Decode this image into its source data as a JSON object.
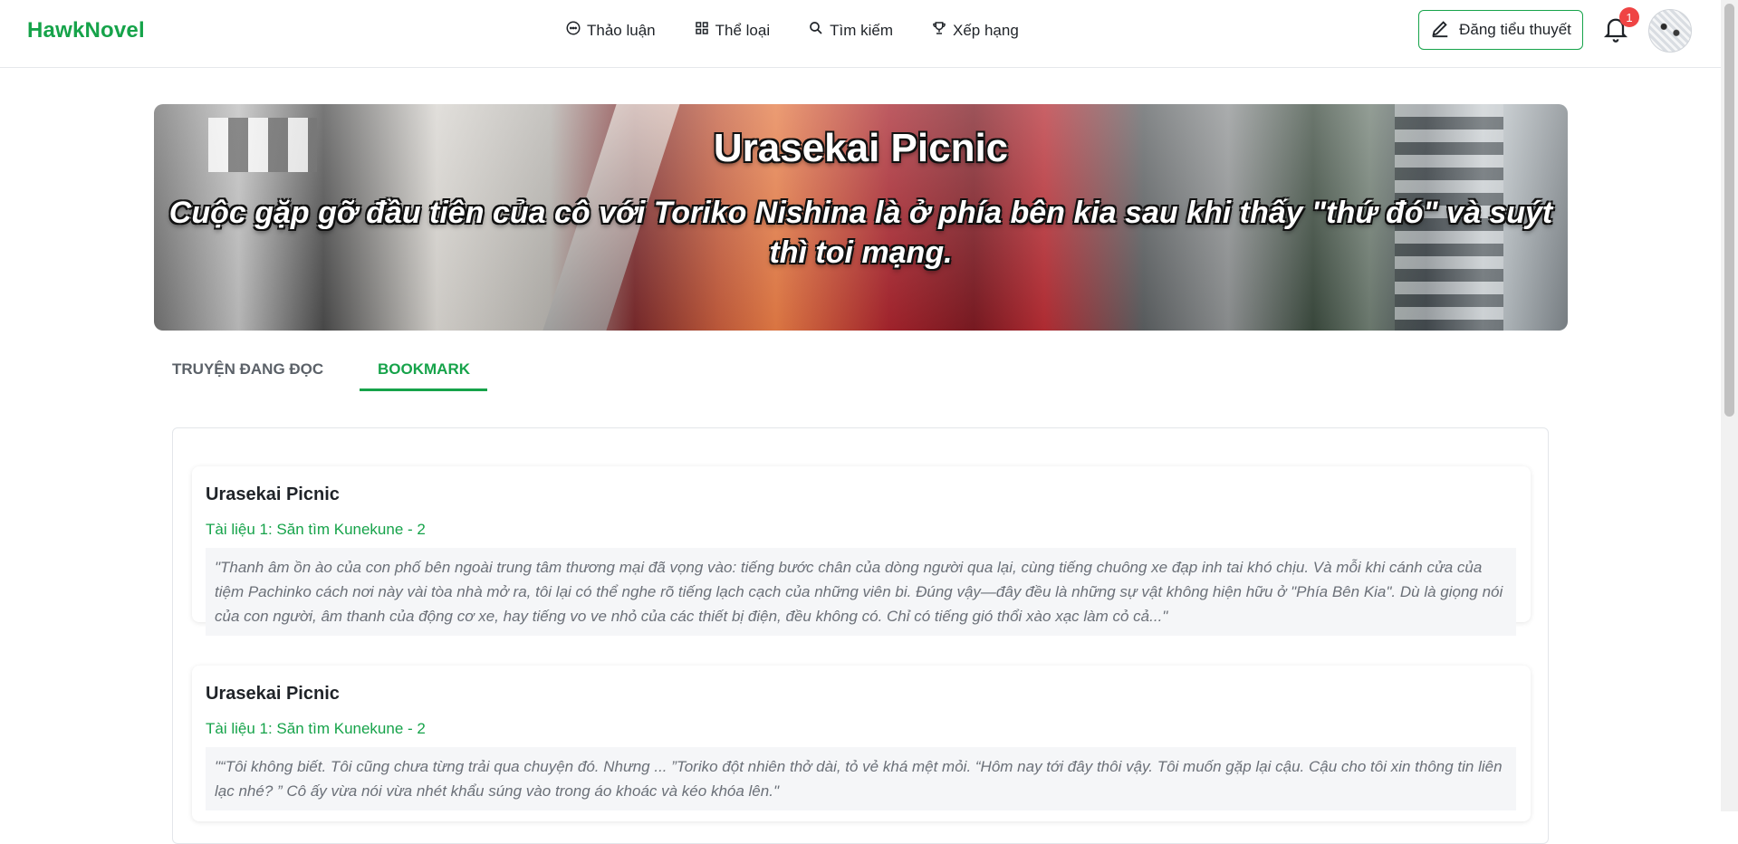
{
  "header": {
    "brand": "HawkNovel",
    "nav": [
      {
        "label": "Thảo luận",
        "icon": "chat-bubble-icon"
      },
      {
        "label": "Thể loại",
        "icon": "grid-icon"
      },
      {
        "label": "Tìm kiếm",
        "icon": "search-icon"
      },
      {
        "label": "Xếp hạng",
        "icon": "trophy-icon"
      }
    ],
    "post_button": "Đăng tiểu thuyết",
    "notification_count": "1"
  },
  "hero": {
    "title": "Urasekai Picnic",
    "subtitle": "Cuộc gặp gỡ đầu tiên của cô với Toriko Nishina là ở phía bên kia sau khi thấy \"thứ đó\" và suýt thì toi mạng."
  },
  "tabs": [
    {
      "label": "TRUYỆN ĐANG ĐỌC",
      "active": false
    },
    {
      "label": "BOOKMARK",
      "active": true
    }
  ],
  "bookmarks": [
    {
      "title": "Urasekai Picnic",
      "chapter": "Tài liệu 1: Săn tìm Kunekune - 2",
      "quote": "\"Thanh âm ồn ào của con phố bên ngoài trung tâm thương mại đã vọng vào: tiếng bước chân của dòng người qua lại, cùng tiếng chuông xe đạp inh tai khó chịu. Và mỗi khi cánh cửa của tiệm Pachinko cách nơi này vài tòa nhà mở ra, tôi lại có thể nghe rõ tiếng lạch cạch của những viên bi. Đúng vậy—đây đều là những sự vật không hiện hữu ở \"Phía Bên Kia\". Dù là giọng nói của con người, âm thanh của động cơ xe, hay tiếng vo ve nhỏ của các thiết bị điện, đều không có. Chỉ có tiếng gió thổi xào xạc làm cỏ cả...\""
    },
    {
      "title": "Urasekai Picnic",
      "chapter": "Tài liệu 1: Săn tìm Kunekune - 2",
      "quote": "\"“Tôi không biết. Tôi cũng chưa từng trải qua chuyện đó. Nhưng ... ”Toriko đột nhiên thở dài, tỏ vẻ khá mệt mỏi. “Hôm nay tới đây thôi vậy. Tôi muốn gặp lại cậu. Cậu cho tôi xin thông tin liên lạc nhé? ” Cô ấy vừa nói vừa nhét khẩu súng vào trong áo khoác và kéo khóa lên.\""
    }
  ],
  "colors": {
    "accent": "#16a34a",
    "badge": "#ef4444"
  }
}
